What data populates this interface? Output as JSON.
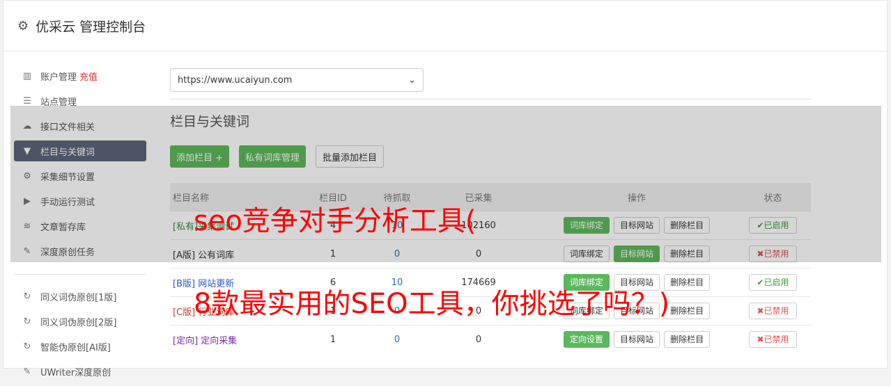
{
  "app": {
    "title": "优采云 管理控制台",
    "icon": "gear-icon"
  },
  "sidebar": {
    "items": [
      {
        "label": "账户管理",
        "extra": "充值",
        "icon": "bar-chart-icon"
      },
      {
        "label": "站点管理",
        "icon": "server-icon"
      },
      {
        "label": "接口文件相关",
        "icon": "cloud-upload-icon"
      },
      {
        "label": "栏目与关键词",
        "icon": "filter-icon",
        "active": true
      },
      {
        "label": "采集细节设置",
        "icon": "gears-icon"
      },
      {
        "label": "手动运行测试",
        "icon": "play-circle-icon"
      },
      {
        "label": "文章暂存库",
        "icon": "database-icon"
      },
      {
        "label": "深度原创任务",
        "icon": "edit-icon"
      }
    ],
    "items2": [
      {
        "label": "同义词伪原创[1版]",
        "icon": "refresh-icon"
      },
      {
        "label": "同义词伪原创[2版]",
        "icon": "refresh-icon"
      },
      {
        "label": "智能伪原创[AI版]",
        "icon": "refresh-icon"
      },
      {
        "label": "UWriter深度原创",
        "icon": "edit-icon"
      }
    ]
  },
  "main": {
    "site_select": {
      "value": "https://www.ucaiyun.com"
    },
    "section_title": "栏目与关键词",
    "buttons": {
      "add": "添加栏目 +",
      "private_lib": "私有词库管理",
      "batch_add": "批量添加栏目"
    },
    "table": {
      "headers": [
        "栏目名称",
        "栏目ID",
        "待抓取",
        "已采集",
        "操作",
        "状态"
      ],
      "rows": [
        {
          "name": "[私有]采集测试",
          "id": "4",
          "pending": "10",
          "done": "102160",
          "op1": "词库绑定",
          "op2": "目标网站",
          "op3": "删除栏目",
          "status": "已启用"
        },
        {
          "name": "[A版] 公有词库",
          "id": "1",
          "pending": "0",
          "done": "0",
          "op1": "词库绑定",
          "op2": "目标网站",
          "op3": "删除栏目",
          "status": "已禁用"
        },
        {
          "name": "[B版] 网站更新",
          "id": "6",
          "pending": "10",
          "done": "174669",
          "op1": "词库绑定",
          "op2": "目标网站",
          "op3": "删除栏目",
          "status": "已启用"
        },
        {
          "name": "[C版] 行业词库",
          "id": "1",
          "pending": "0",
          "done": "0",
          "op1": "词库绑定",
          "op2": "目标网站",
          "op3": "删除栏目",
          "status": "已禁用"
        },
        {
          "name": "[定向] 定向采集",
          "id": "1",
          "pending": "0",
          "done": "0",
          "op1": "定向设置",
          "op2": "目标网站",
          "op3": "删除栏目",
          "status": "已禁用"
        }
      ]
    }
  },
  "watermark": {
    "line1": "seo竞争对手分析工具(",
    "line2": "8款最实用的SEO工具，你挑选了吗？)"
  },
  "colors": {
    "accent_green": "#5cb85c",
    "sidebar_active": "#5a6677",
    "watermark": "#ff0000",
    "danger": "#d9534f"
  }
}
